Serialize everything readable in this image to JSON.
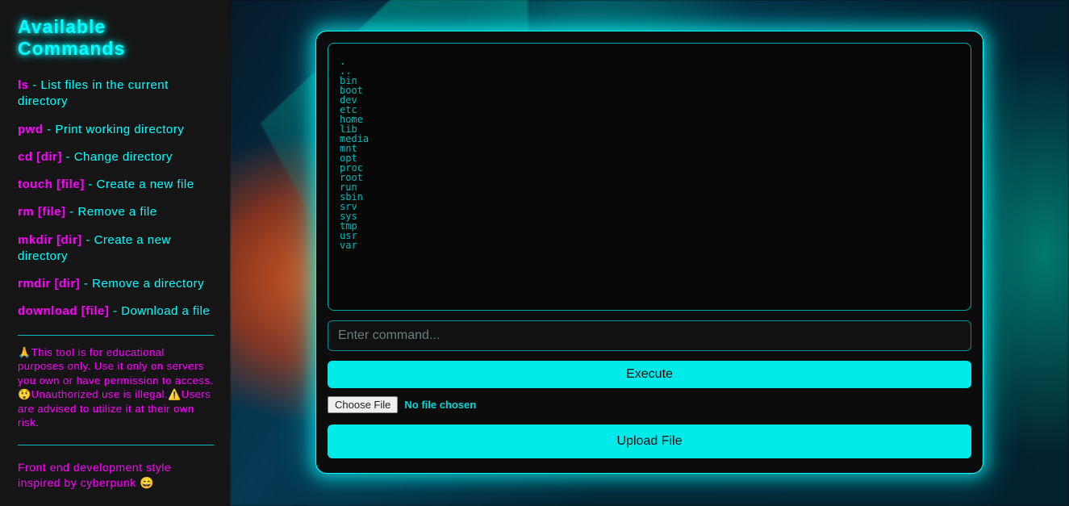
{
  "sidebar": {
    "title": "Available Commands",
    "commands": [
      {
        "name": "ls",
        "desc": "List files in the current directory"
      },
      {
        "name": "pwd",
        "desc": "Print working directory"
      },
      {
        "name": "cd [dir]",
        "desc": "Change directory"
      },
      {
        "name": "touch [file]",
        "desc": "Create a new file"
      },
      {
        "name": "rm [file]",
        "desc": "Remove a file"
      },
      {
        "name": "mkdir [dir]",
        "desc": "Create a new directory"
      },
      {
        "name": "rmdir [dir]",
        "desc": "Remove a directory"
      },
      {
        "name": "download [file]",
        "desc": "Download a file"
      }
    ],
    "disclaimer": "🙏This tool is for educational purposes only. Use it only on servers you own or have permission to access. 😲Unauthorized use is illegal.⚠️Users are advised to utilize it at their own risk.",
    "credits": "Front end development style inspired by cyberpunk 😄"
  },
  "terminal": {
    "output": ".\n..\nbin\nboot\ndev\netc\nhome\nlib\nmedia\nmnt\nopt\nproc\nroot\nrun\nsbin\nsrv\nsys\ntmp\nusr\nvar"
  },
  "input": {
    "placeholder": "Enter command...",
    "value": ""
  },
  "buttons": {
    "execute": "Execute",
    "upload": "Upload File"
  },
  "file": {
    "choose_label": "Choose File",
    "status": "No file chosen"
  },
  "colors": {
    "cyan": "#00ffff",
    "magenta": "#ff00ff",
    "bg": "#0c0c0c"
  }
}
